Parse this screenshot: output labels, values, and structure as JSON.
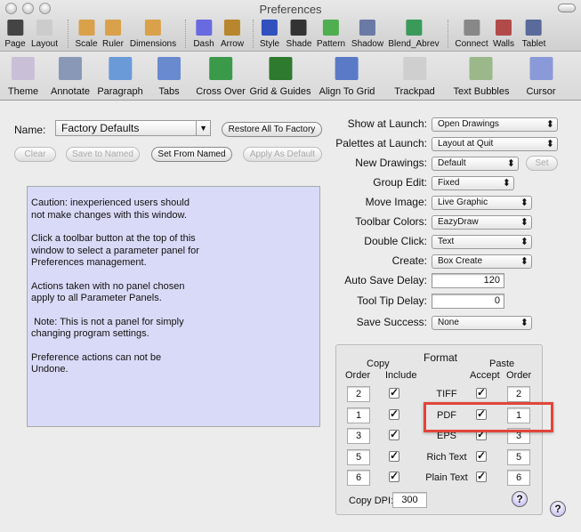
{
  "window": {
    "title": "Preferences"
  },
  "toolbar_row1": [
    {
      "label": "Page",
      "icon": "page-icon",
      "color": "#444"
    },
    {
      "label": "Layout",
      "icon": "layout-icon",
      "color": "#ccc"
    },
    {
      "label": "Scale",
      "icon": "scale-icon",
      "color": "#d9a24a"
    },
    {
      "label": "Ruler",
      "icon": "ruler-icon",
      "color": "#d9a24a"
    },
    {
      "label": "Dimensions",
      "icon": "dimensions-icon",
      "color": "#d9a24a"
    },
    {
      "label": "Dash",
      "icon": "dash-icon",
      "color": "#6a6ae0"
    },
    {
      "label": "Arrow",
      "icon": "arrow-icon",
      "color": "#b8862d"
    },
    {
      "label": "Style",
      "icon": "style-icon",
      "color": "#3050c0"
    },
    {
      "label": "Shade",
      "icon": "shade-icon",
      "color": "#333"
    },
    {
      "label": "Pattern",
      "icon": "pattern-icon",
      "color": "#4fae4f"
    },
    {
      "label": "Shadow",
      "icon": "shadow-icon",
      "color": "#6a7aa6"
    },
    {
      "label": "Blend_Abrev",
      "icon": "blend-icon",
      "color": "#3a9a5a"
    },
    {
      "label": "Connect",
      "icon": "connect-icon",
      "color": "#888"
    },
    {
      "label": "Walls",
      "icon": "walls-icon",
      "color": "#b24a4a"
    },
    {
      "label": "Tablet",
      "icon": "tablet-icon",
      "color": "#5a6a9a"
    }
  ],
  "toolbar_row2": [
    {
      "label": "Theme",
      "icon": "theme-icon",
      "color": "#c9c0d8"
    },
    {
      "label": "Annotate",
      "icon": "annotate-icon",
      "color": "#8a98b8"
    },
    {
      "label": "Paragraph",
      "icon": "paragraph-icon",
      "color": "#6a9ad8"
    },
    {
      "label": "Tabs",
      "icon": "tabs-icon",
      "color": "#6a8ad0"
    },
    {
      "label": "Cross Over",
      "icon": "cross-over-icon",
      "color": "#3a9a4a"
    },
    {
      "label": "Grid & Guides",
      "icon": "grid-icon",
      "color": "#2e7a2e"
    },
    {
      "label": "Align To Grid",
      "icon": "align-grid-icon",
      "color": "#5a7ac8"
    },
    {
      "label": "Trackpad",
      "icon": "trackpad-icon",
      "color": "#cfcfcf"
    },
    {
      "label": "Text Bubbles",
      "icon": "text-bubbles-icon",
      "color": "#9ab88a"
    },
    {
      "label": "Cursor",
      "icon": "cursor-icon",
      "color": "#8a9ad8"
    }
  ],
  "left": {
    "name_label": "Name:",
    "name_value": "Factory Defaults",
    "restore": "Restore All To Factory",
    "clear": "Clear",
    "save_named": "Save to Named",
    "set_from_named": "Set From Named",
    "apply_default": "Apply As Default",
    "info": [
      "Caution: inexperienced users should not make changes with this window.",
      "Click a toolbar button at the top of this window to select a parameter panel for Preferences management.",
      "Actions taken with no panel chosen apply to all Parameter Panels.",
      " Note: This is not a panel for simply changing program settings.",
      "Preference actions can not be Undone."
    ]
  },
  "right": {
    "show_launch": {
      "label": "Show at Launch:",
      "value": "Open Drawings"
    },
    "palettes": {
      "label": "Palettes at Launch:",
      "value": "Layout at Quit"
    },
    "new_drawings": {
      "label": "New Drawings:",
      "value": "Default",
      "button": "Set"
    },
    "group_edit": {
      "label": "Group Edit:",
      "value": "Fixed"
    },
    "move_image": {
      "label": "Move Image:",
      "value": "Live Graphic"
    },
    "toolbar_colors": {
      "label": "Toolbar Colors:",
      "value": "EazyDraw"
    },
    "double_click": {
      "label": "Double Click:",
      "value": "Text"
    },
    "create": {
      "label": "Create:",
      "value": "Box Create"
    },
    "auto_save": {
      "label": "Auto Save Delay:",
      "value": "120"
    },
    "tooltip": {
      "label": "Tool Tip Delay:",
      "value": "0"
    },
    "save_success": {
      "label": "Save Success:",
      "value": "None"
    }
  },
  "format": {
    "title": "Format",
    "copy": "Copy",
    "paste": "Paste",
    "copy_order": "Order",
    "include": "Include",
    "accept": "Accept",
    "paste_order": "Order",
    "rows": [
      {
        "copy_order": "2",
        "include": true,
        "format": "TIFF",
        "accept": true,
        "paste_order": "2"
      },
      {
        "copy_order": "1",
        "include": true,
        "format": "PDF",
        "accept": true,
        "paste_order": "1"
      },
      {
        "copy_order": "3",
        "include": true,
        "format": "EPS",
        "accept": true,
        "paste_order": "3"
      },
      {
        "copy_order": "5",
        "include": true,
        "format": "Rich Text",
        "accept": true,
        "paste_order": "5"
      },
      {
        "copy_order": "6",
        "include": true,
        "format": "Plain Text",
        "accept": true,
        "paste_order": "6"
      }
    ],
    "dpi_label": "Copy DPI:",
    "dpi_value": "300",
    "help": "?"
  },
  "highlight_color": "#e0463a"
}
